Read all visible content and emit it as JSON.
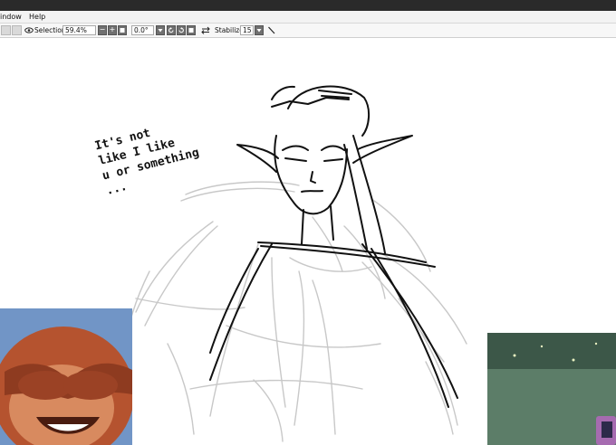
{
  "menu": {
    "window": "indow",
    "help": "Help"
  },
  "toolbar": {
    "selection_label": "Selection",
    "zoom": "59.4%",
    "zoom_minus": "−",
    "zoom_plus": "+",
    "rotation": "0.0°",
    "stabilizer_label": "Stabilizer",
    "stabilizer_value": "15",
    "icons": [
      "eye-icon",
      "swap-arrows-icon",
      "brush-icon",
      "rotate-left-icon",
      "rotate-right-icon",
      "reset-icon",
      "dropdown-arrow-icon"
    ]
  },
  "canvas": {
    "caption_lines": [
      "It's not",
      "like I like",
      "u or something",
      "..."
    ]
  },
  "colors": {
    "titlebar": "#2a2a2a",
    "canvas": "#ffffff",
    "sketch": "#c8c8c8",
    "ink": "#111111",
    "webcam_left_bg": "#6e8fbf",
    "monkey": "#b5532f",
    "webcam_right_bg": "#4d6b57"
  }
}
